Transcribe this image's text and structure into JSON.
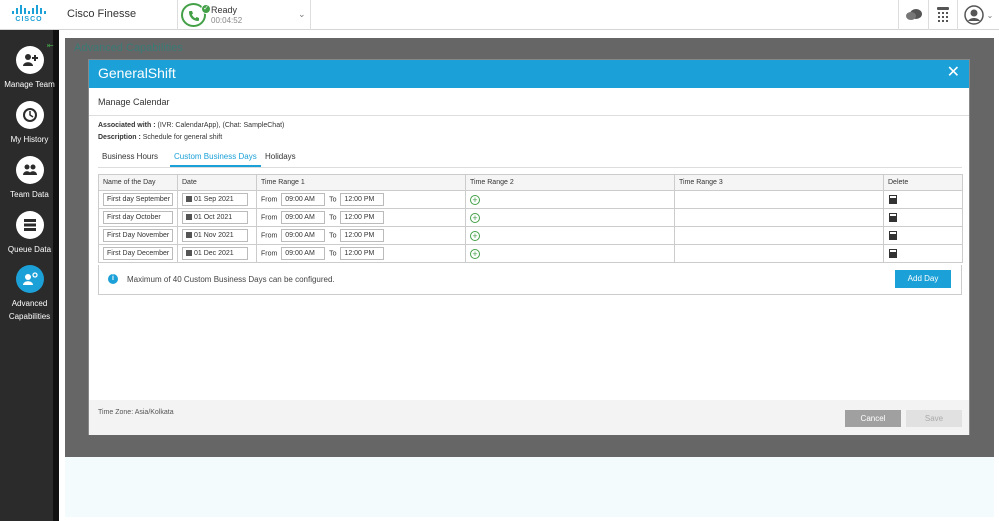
{
  "topbar": {
    "logo_text": "CISCO",
    "app_title": "Cisco Finesse",
    "state": {
      "label": "Ready",
      "timer": "00:04:52"
    }
  },
  "sidebar": {
    "items": [
      {
        "label": "Manage Team",
        "icon": "manage-team-icon"
      },
      {
        "label": "My History",
        "icon": "history-icon"
      },
      {
        "label": "Team Data",
        "icon": "team-icon"
      },
      {
        "label": "Queue Data",
        "icon": "queue-icon"
      },
      {
        "label": "Advanced Capabilities",
        "icon": "advanced-capabilities-icon",
        "active": true
      }
    ]
  },
  "background": {
    "title": "Advanced Capabilities"
  },
  "modal": {
    "title": "GeneralShift",
    "subtitle": "Manage Calendar",
    "associated_label": "Associated with :",
    "associated_value": "(IVR: CalendarApp), (Chat: SampleChat)",
    "description_label": "Description :",
    "description_value": "Schedule for general shift",
    "tabs": [
      "Business Hours",
      "Custom Business Days",
      "Holidays"
    ],
    "active_tab": "Custom Business Days",
    "columns": [
      "Name of the Day",
      "Date",
      "Time Range 1",
      "Time Range 2",
      "Time Range 3",
      "Delete"
    ],
    "from_label": "From",
    "to_label": "To",
    "rows": [
      {
        "name": "First day September",
        "date": "01 Sep 2021",
        "from": "09:00 AM",
        "to": "12:00 PM"
      },
      {
        "name": "First day October",
        "date": "01 Oct 2021",
        "from": "09:00 AM",
        "to": "12:00 PM"
      },
      {
        "name": "First Day November",
        "date": "01 Nov 2021",
        "from": "09:00 AM",
        "to": "12:00 PM"
      },
      {
        "name": "First Day December",
        "date": "01 Dec 2021",
        "from": "09:00 AM",
        "to": "12:00 PM"
      }
    ],
    "info": "Maximum of 40 Custom Business Days can be configured.",
    "add_day": "Add Day",
    "timezone": "Time Zone: Asia/Kolkata",
    "cancel": "Cancel",
    "save": "Save"
  },
  "colors": {
    "accent": "#1ba0d7",
    "ready": "#43a047",
    "sidebar": "#2b2b2b"
  }
}
